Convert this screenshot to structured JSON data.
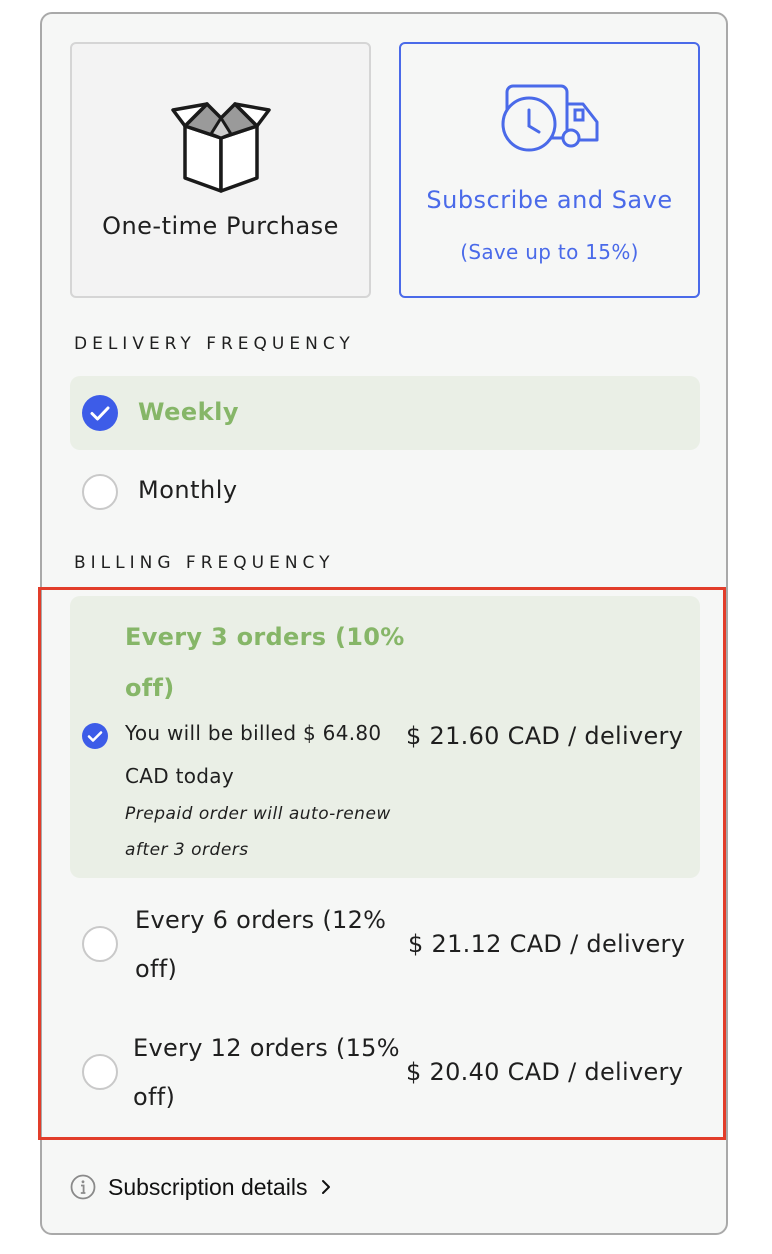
{
  "purchase_options": {
    "one_time": {
      "label": "One-time Purchase",
      "icon": "open-box-icon"
    },
    "subscribe": {
      "label": "Subscribe and Save",
      "sublabel": "(Save up to 15%)",
      "icon": "delivery-truck-clock-icon"
    }
  },
  "delivery_frequency": {
    "heading": "DELIVERY FREQUENCY",
    "options": [
      {
        "label": "Weekly",
        "selected": true
      },
      {
        "label": "Monthly",
        "selected": false
      }
    ]
  },
  "billing_frequency": {
    "heading": "BILLING FREQUENCY",
    "options": [
      {
        "title_line1": "Every 3 orders (10%",
        "title_line2": "off)",
        "billed_line1": "You will be billed $ 64.80",
        "billed_line2": "CAD today",
        "note_line1": "Prepaid order will auto-renew",
        "note_line2": "after 3 orders",
        "price": "$ 21.60 CAD  / delivery",
        "selected": true
      },
      {
        "title_line1": "Every 6 orders (12%",
        "title_line2": "off)",
        "price": "$ 21.12 CAD  / delivery",
        "selected": false
      },
      {
        "title_line1": "Every 12 orders (15%",
        "title_line2": "off)",
        "price": "$ 20.40 CAD  / delivery",
        "selected": false
      }
    ]
  },
  "footer": {
    "details_label": "Subscription details",
    "icon": "info-icon"
  },
  "colors": {
    "accent": "#4a6ae9",
    "selected_green": "#86b668",
    "highlight_red": "#e23d2a",
    "selected_bg": "#eaefe6"
  }
}
